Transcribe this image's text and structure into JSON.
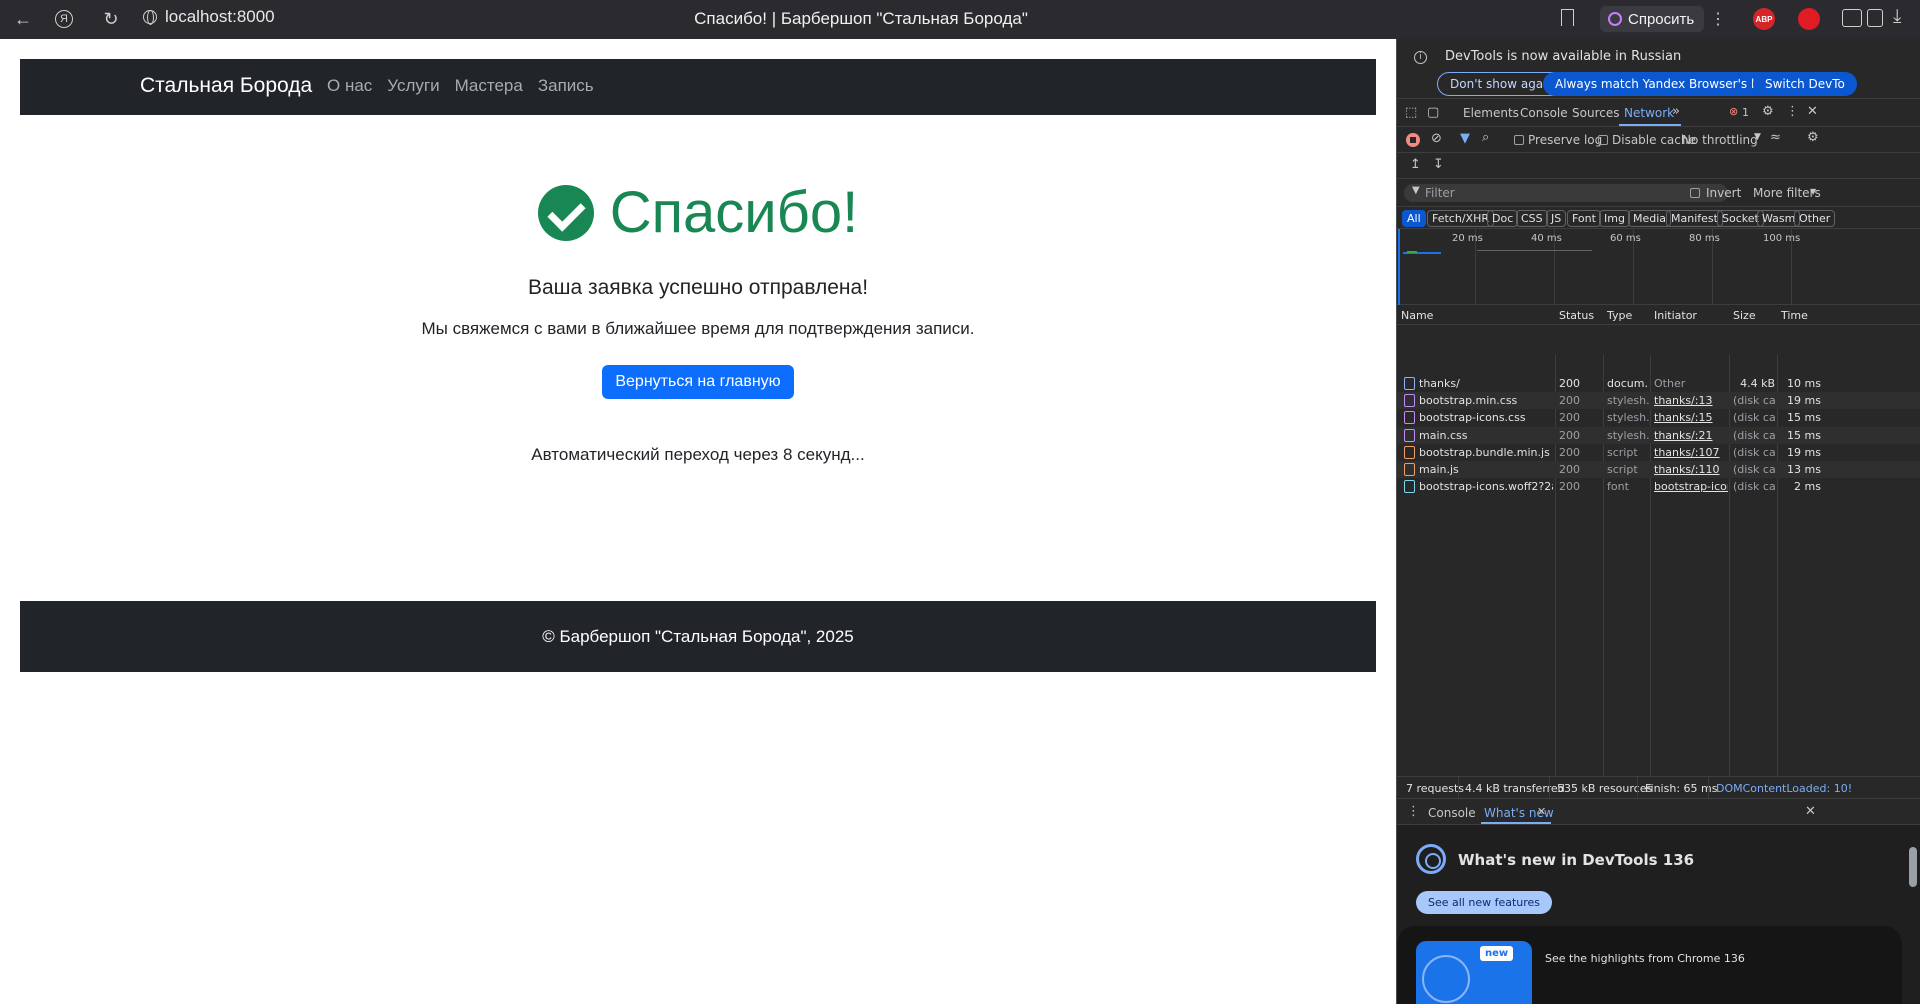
{
  "browser": {
    "url": "localhost:8000",
    "tab_title": "Спасибо! | Барбершоп \"Стальная Борода\"",
    "ask_label": "Спросить",
    "abp_label": "ABP"
  },
  "site": {
    "brand": "Стальная Борода",
    "nav": [
      "О нас",
      "Услуги",
      "Мастера",
      "Запись"
    ],
    "heading": "Спасибо!",
    "lead": "Ваша заявка успешно отправлена!",
    "sub": "Мы свяжемся с вами в ближайшее время для подтверждения записи.",
    "back_button": "Вернуться на главную",
    "auto_redirect": "Автоматический переход через 8 секунд...",
    "footer": "© Барбершоп \"Стальная Борода\", 2025",
    "colors": {
      "navbar": "#212529",
      "success": "#198754",
      "primary": "#0d6efd"
    }
  },
  "devtools": {
    "info_message": "DevTools is now available in Russian",
    "info_buttons": [
      "Don't show again",
      "Always match Yandex Browser's language",
      "Switch DevTo"
    ],
    "tabs": [
      "Elements",
      "Console",
      "Sources",
      "Network"
    ],
    "active_tab": "Network",
    "error_count": "1",
    "preserve_log": "Preserve log",
    "disable_cache": "Disable cache",
    "throttling": "No throttling",
    "filter_placeholder": "Filter",
    "invert": "Invert",
    "more_filters": "More filters",
    "types": [
      "All",
      "Fetch/XHR",
      "Doc",
      "CSS",
      "JS",
      "Font",
      "Img",
      "Media",
      "Manifest",
      "Socket",
      "Wasm",
      "Other"
    ],
    "timeline_ticks": [
      "20 ms",
      "40 ms",
      "60 ms",
      "80 ms",
      "100 ms"
    ],
    "columns": [
      "Name",
      "Status",
      "Type",
      "Initiator",
      "Size",
      "Time"
    ],
    "requests": [
      {
        "name": "thanks/",
        "status": "200",
        "type": "docum...",
        "initiator": "Other",
        "size": "4.4 kB",
        "time": "10 ms",
        "icon": "document-icon"
      },
      {
        "name": "bootstrap.min.css",
        "status": "200",
        "type": "stylesh...",
        "initiator": "thanks/:13",
        "size": "(disk ca...",
        "time": "19 ms",
        "icon": "stylesheet-icon"
      },
      {
        "name": "bootstrap-icons.css",
        "status": "200",
        "type": "stylesh...",
        "initiator": "thanks/:15",
        "size": "(disk ca...",
        "time": "15 ms",
        "icon": "stylesheet-icon"
      },
      {
        "name": "main.css",
        "status": "200",
        "type": "stylesh...",
        "initiator": "thanks/:21",
        "size": "(disk ca...",
        "time": "15 ms",
        "icon": "stylesheet-icon"
      },
      {
        "name": "bootstrap.bundle.min.js",
        "status": "200",
        "type": "script",
        "initiator": "thanks/:107",
        "size": "(disk ca...",
        "time": "19 ms",
        "icon": "script-icon"
      },
      {
        "name": "main.js",
        "status": "200",
        "type": "script",
        "initiator": "thanks/:110",
        "size": "(disk ca...",
        "time": "13 ms",
        "icon": "script-icon"
      },
      {
        "name": "bootstrap-icons.woff2?2ab2c...",
        "status": "200",
        "type": "font",
        "initiator": "bootstrap-icons.c",
        "size": "(disk ca...",
        "time": "2 ms",
        "icon": "font-icon"
      }
    ],
    "summary": {
      "requests": "7 requests",
      "transferred": "4.4 kB transferred",
      "resources": "535 kB resources",
      "finish": "Finish: 65 ms",
      "dcl": "DOMContentLoaded: 10!"
    },
    "drawer_tabs": [
      "Console",
      "What's new"
    ],
    "whats_new": {
      "title": "What's new in DevTools 136",
      "button": "See all new features",
      "badge": "new",
      "highlight": "See the highlights from Chrome 136"
    }
  }
}
